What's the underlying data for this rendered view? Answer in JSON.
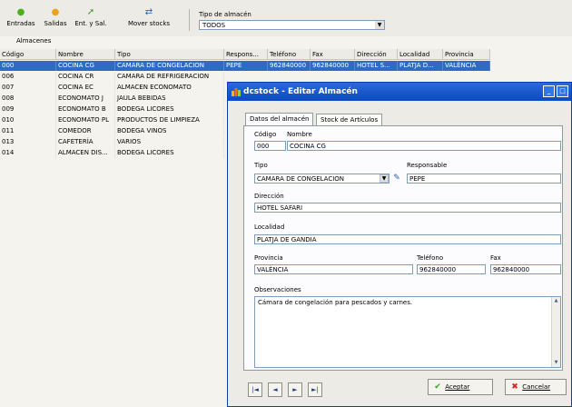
{
  "toolbar": {
    "buttons": [
      {
        "label": "Entradas",
        "icon": "entradas-icon"
      },
      {
        "label": "Salidas",
        "icon": "salidas-icon"
      },
      {
        "label": "Ent. y Sal.",
        "icon": "ent-y-sal-icon"
      },
      {
        "label": "Mover stocks",
        "icon": "mover-stocks-icon"
      }
    ],
    "tipo_label": "Tipo de almacén",
    "tipo_value": "TODOS"
  },
  "grid": {
    "title": "Almacenes",
    "columns": [
      "Código",
      "Nombre",
      "Tipo",
      "Respons...",
      "Teléfono",
      "Fax",
      "Dirección",
      "Localidad",
      "Provincia"
    ],
    "rows": [
      {
        "codigo": "000",
        "nombre": "COCINA CG",
        "tipo": "CAMARA DE CONGELACION",
        "responsable": "PEPE",
        "telefono": "962840000",
        "fax": "962840000",
        "direccion": "HOTEL S...",
        "localidad": "PLATJA D...",
        "provincia": "VALÈNCIA",
        "selected": true
      },
      {
        "codigo": "006",
        "nombre": "COCINA CR",
        "tipo": "CAMARA DE REFRIGERACION",
        "selected": false
      },
      {
        "codigo": "007",
        "nombre": "COCINA EC",
        "tipo": "ALMACEN ECONOMATO",
        "selected": false
      },
      {
        "codigo": "008",
        "nombre": "ECONOMATO J",
        "tipo": "JAULA BEBIDAS",
        "selected": false
      },
      {
        "codigo": "009",
        "nombre": "ECONOMATO B",
        "tipo": "BODEGA LICORES",
        "selected": false
      },
      {
        "codigo": "010",
        "nombre": "ECONOMATO PL",
        "tipo": "PRODUCTOS DE LIMPIEZA",
        "selected": false
      },
      {
        "codigo": "011",
        "nombre": "COMEDOR",
        "tipo": "BODEGA VINOS",
        "selected": false
      },
      {
        "codigo": "013",
        "nombre": "CAFETERÍA",
        "tipo": "VARIOS",
        "selected": false
      },
      {
        "codigo": "014",
        "nombre": "ALMACEN DIS...",
        "tipo": "BODEGA LICORES",
        "selected": false
      }
    ]
  },
  "dialog": {
    "title": "dcstock - Editar Almacén",
    "tabs": [
      "Datos del almacén",
      "Stock de Artículos"
    ],
    "labels": {
      "codigo": "Código",
      "nombre": "Nombre",
      "tipo": "Tipo",
      "responsable": "Responsable",
      "direccion": "Dirección",
      "localidad": "Localidad",
      "provincia": "Provincia",
      "telefono": "Teléfono",
      "fax": "Fax",
      "observaciones": "Observaciones"
    },
    "values": {
      "codigo": "000",
      "nombre": "COCINA CG",
      "tipo": "CAMARA DE CONGELACION",
      "responsable": "PEPE",
      "direccion": "HOTEL SAFARI",
      "localidad": "PLATJA DE GANDIA",
      "provincia": "VALÈNCIA",
      "telefono": "962840000",
      "fax": "962840000",
      "observaciones": "Cámara de congelación para pescados y carnes."
    },
    "nav": [
      "|◄",
      "◄",
      "►",
      "►|"
    ],
    "aceptar": "Aceptar",
    "cancelar": "Cancelar"
  },
  "colors": {
    "selection": "#316ac5",
    "titlebar": "#0a49c2"
  }
}
